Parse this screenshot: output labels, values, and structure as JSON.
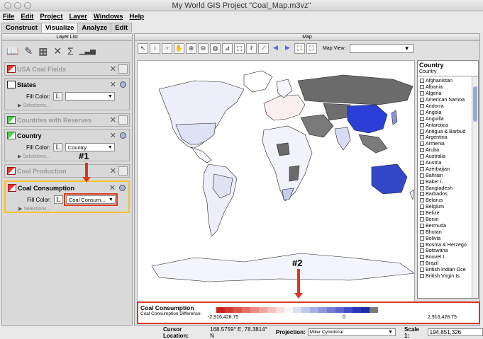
{
  "window": {
    "title": "My World GIS Project \"Coal_Map.m3vz\""
  },
  "menu": [
    {
      "id": "file",
      "label": "File"
    },
    {
      "id": "edit",
      "label": "Edit"
    },
    {
      "id": "project",
      "label": "Project"
    },
    {
      "id": "layer",
      "label": "Layer"
    },
    {
      "id": "windows",
      "label": "Windows"
    },
    {
      "id": "help",
      "label": "Help"
    }
  ],
  "tabs": [
    "Construct",
    "Visualize",
    "Analyze",
    "Edit"
  ],
  "layer_list": {
    "header": "Layer List",
    "layers": [
      {
        "name": "USA Coal Fields",
        "state": "collapsed"
      },
      {
        "name": "States",
        "fill_label": "Fill Color:",
        "fill_value": "",
        "selections": "Selections..."
      },
      {
        "name": "Countries with Reserves",
        "state": "collapsed"
      },
      {
        "name": "Country",
        "fill_label": "Fill Color:",
        "fill_value": "Country",
        "selections": "Selections..."
      },
      {
        "name": "Coal Production",
        "state": "collapsed"
      },
      {
        "name": "Coal Consumption",
        "fill_label": "Fill Color:",
        "fill_value": "Coal Consum...",
        "selections": "Selections..."
      }
    ],
    "lbutton": "L",
    "annotation": "#1"
  },
  "map": {
    "header": "Map",
    "map_view_label": "Map View:",
    "annotation": "#2"
  },
  "country_list": {
    "title": "Country",
    "subtitle": "Country",
    "items": [
      "Afghanistan",
      "Albania",
      "Algeria",
      "American Samoa",
      "Andorra",
      "Angola",
      "Anguilla",
      "Antarctica",
      "Antigua & Barbud",
      "Argentina",
      "Armenia",
      "Aruba",
      "Australia",
      "Austria",
      "Azerbaijan",
      "Bahrain",
      "Baker I.",
      "Bangladesh",
      "Barbados",
      "Belarus",
      "Belgium",
      "Belize",
      "Benin",
      "Bermuda",
      "Bhutan",
      "Bolivia",
      "Bosnia & Herzego",
      "Botswana",
      "Bouvet I.",
      "Brazil",
      "British Indian Oce",
      "British Virgin Is."
    ]
  },
  "legend": {
    "title": "Coal Consumption",
    "subtitle": "Coal Consumption Difference",
    "min": "-2,916,428.75",
    "mid": "0",
    "max": "2,916,428.75",
    "colors": [
      "#c8201a",
      "#d3392e",
      "#dc5446",
      "#e46e62",
      "#eb8a80",
      "#f1a59e",
      "#f6c1bc",
      "#fadcd9",
      "#f6f6f6",
      "#dcdff3",
      "#c2c7ec",
      "#a8aee4",
      "#8e96dd",
      "#747dd6",
      "#5a65ce",
      "#3f4dc7",
      "#2536bd",
      "#1b2ba8",
      "#7a7a7a"
    ]
  },
  "status": {
    "cursor_label": "Cursor Location:",
    "cursor_value": "168.5759° E, 78.3814° N",
    "projection_label": "Projection:",
    "projection_value": "Miller Cylindrical",
    "scale_label": "Scale 1:",
    "scale_value": "194,851,326"
  }
}
